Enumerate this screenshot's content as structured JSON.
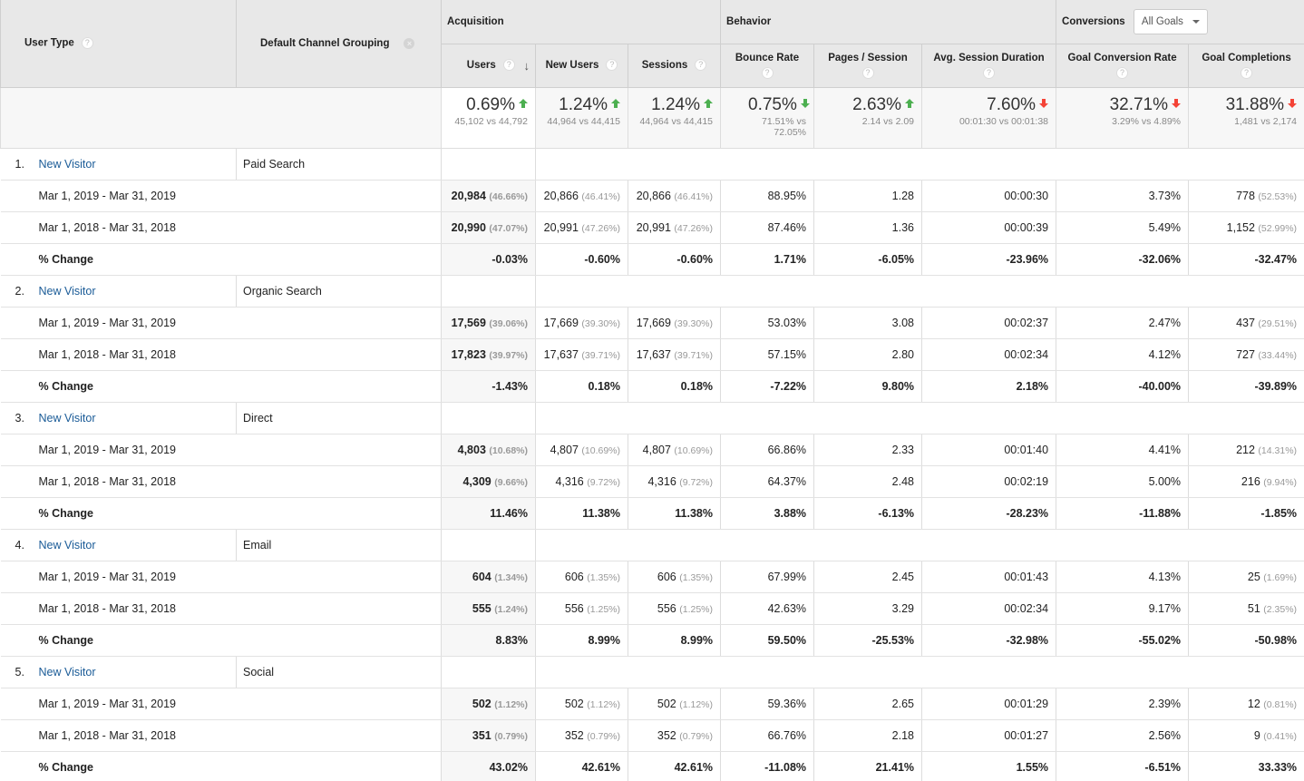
{
  "header": {
    "user_type": "User Type",
    "channel_grouping": "Default Channel Grouping",
    "groups": {
      "acquisition": "Acquisition",
      "behavior": "Behavior",
      "conversions": "Conversions"
    },
    "goal_select": "All Goals",
    "metrics": {
      "users": "Users",
      "new_users": "New Users",
      "sessions": "Sessions",
      "bounce_rate": "Bounce Rate",
      "pages_session": "Pages / Session",
      "avg_duration": "Avg. Session Duration",
      "goal_conv_rate": "Goal Conversion Rate",
      "goal_completions": "Goal Completions"
    },
    "help_icon": "?"
  },
  "summary": {
    "users": {
      "change": "0.69%",
      "direction": "up",
      "color": "#4caf50",
      "compare": "45,102 vs 44,792"
    },
    "new_users": {
      "change": "1.24%",
      "direction": "up",
      "color": "#4caf50",
      "compare": "44,964 vs 44,415"
    },
    "sessions": {
      "change": "1.24%",
      "direction": "up",
      "color": "#4caf50",
      "compare": "44,964 vs 44,415"
    },
    "bounce_rate": {
      "change": "0.75%",
      "direction": "down",
      "color": "#4caf50",
      "compare": "71.51% vs 72.05%"
    },
    "pages_session": {
      "change": "2.63%",
      "direction": "up",
      "color": "#4caf50",
      "compare": "2.14 vs 2.09"
    },
    "avg_duration": {
      "change": "7.60%",
      "direction": "down",
      "color": "#f44336",
      "compare": "00:01:30 vs 00:01:38"
    },
    "goal_conv_rate": {
      "change": "32.71%",
      "direction": "down",
      "color": "#f44336",
      "compare": "3.29% vs 4.89%"
    },
    "goal_completions": {
      "change": "31.88%",
      "direction": "down",
      "color": "#f44336",
      "compare": "1,481 vs 2,174"
    }
  },
  "change_label": "% Change",
  "rows": [
    {
      "index": "1.",
      "user_type": "New Visitor",
      "channel": "Paid Search",
      "periods": [
        {
          "label": "Mar 1, 2019 - Mar 31, 2019",
          "users": "20,984",
          "users_pct": "(46.66%)",
          "new_users": "20,866",
          "new_users_pct": "(46.41%)",
          "sessions": "20,866",
          "sessions_pct": "(46.41%)",
          "bounce_rate": "88.95%",
          "pages_session": "1.28",
          "avg_duration": "00:00:30",
          "goal_conv_rate": "3.73%",
          "goal_completions": "778",
          "goal_completions_pct": "(52.53%)"
        },
        {
          "label": "Mar 1, 2018 - Mar 31, 2018",
          "users": "20,990",
          "users_pct": "(47.07%)",
          "new_users": "20,991",
          "new_users_pct": "(47.26%)",
          "sessions": "20,991",
          "sessions_pct": "(47.26%)",
          "bounce_rate": "87.46%",
          "pages_session": "1.36",
          "avg_duration": "00:00:39",
          "goal_conv_rate": "5.49%",
          "goal_completions": "1,152",
          "goal_completions_pct": "(52.99%)"
        }
      ],
      "change": {
        "users": "-0.03%",
        "new_users": "-0.60%",
        "sessions": "-0.60%",
        "bounce_rate": "1.71%",
        "pages_session": "-6.05%",
        "avg_duration": "-23.96%",
        "goal_conv_rate": "-32.06%",
        "goal_completions": "-32.47%"
      }
    },
    {
      "index": "2.",
      "user_type": "New Visitor",
      "channel": "Organic Search",
      "periods": [
        {
          "label": "Mar 1, 2019 - Mar 31, 2019",
          "users": "17,569",
          "users_pct": "(39.06%)",
          "new_users": "17,669",
          "new_users_pct": "(39.30%)",
          "sessions": "17,669",
          "sessions_pct": "(39.30%)",
          "bounce_rate": "53.03%",
          "pages_session": "3.08",
          "avg_duration": "00:02:37",
          "goal_conv_rate": "2.47%",
          "goal_completions": "437",
          "goal_completions_pct": "(29.51%)"
        },
        {
          "label": "Mar 1, 2018 - Mar 31, 2018",
          "users": "17,823",
          "users_pct": "(39.97%)",
          "new_users": "17,637",
          "new_users_pct": "(39.71%)",
          "sessions": "17,637",
          "sessions_pct": "(39.71%)",
          "bounce_rate": "57.15%",
          "pages_session": "2.80",
          "avg_duration": "00:02:34",
          "goal_conv_rate": "4.12%",
          "goal_completions": "727",
          "goal_completions_pct": "(33.44%)"
        }
      ],
      "change": {
        "users": "-1.43%",
        "new_users": "0.18%",
        "sessions": "0.18%",
        "bounce_rate": "-7.22%",
        "pages_session": "9.80%",
        "avg_duration": "2.18%",
        "goal_conv_rate": "-40.00%",
        "goal_completions": "-39.89%"
      }
    },
    {
      "index": "3.",
      "user_type": "New Visitor",
      "channel": "Direct",
      "periods": [
        {
          "label": "Mar 1, 2019 - Mar 31, 2019",
          "users": "4,803",
          "users_pct": "(10.68%)",
          "new_users": "4,807",
          "new_users_pct": "(10.69%)",
          "sessions": "4,807",
          "sessions_pct": "(10.69%)",
          "bounce_rate": "66.86%",
          "pages_session": "2.33",
          "avg_duration": "00:01:40",
          "goal_conv_rate": "4.41%",
          "goal_completions": "212",
          "goal_completions_pct": "(14.31%)"
        },
        {
          "label": "Mar 1, 2018 - Mar 31, 2018",
          "users": "4,309",
          "users_pct": "(9.66%)",
          "new_users": "4,316",
          "new_users_pct": "(9.72%)",
          "sessions": "4,316",
          "sessions_pct": "(9.72%)",
          "bounce_rate": "64.37%",
          "pages_session": "2.48",
          "avg_duration": "00:02:19",
          "goal_conv_rate": "5.00%",
          "goal_completions": "216",
          "goal_completions_pct": "(9.94%)"
        }
      ],
      "change": {
        "users": "11.46%",
        "new_users": "11.38%",
        "sessions": "11.38%",
        "bounce_rate": "3.88%",
        "pages_session": "-6.13%",
        "avg_duration": "-28.23%",
        "goal_conv_rate": "-11.88%",
        "goal_completions": "-1.85%"
      }
    },
    {
      "index": "4.",
      "user_type": "New Visitor",
      "channel": "Email",
      "periods": [
        {
          "label": "Mar 1, 2019 - Mar 31, 2019",
          "users": "604",
          "users_pct": "(1.34%)",
          "new_users": "606",
          "new_users_pct": "(1.35%)",
          "sessions": "606",
          "sessions_pct": "(1.35%)",
          "bounce_rate": "67.99%",
          "pages_session": "2.45",
          "avg_duration": "00:01:43",
          "goal_conv_rate": "4.13%",
          "goal_completions": "25",
          "goal_completions_pct": "(1.69%)"
        },
        {
          "label": "Mar 1, 2018 - Mar 31, 2018",
          "users": "555",
          "users_pct": "(1.24%)",
          "new_users": "556",
          "new_users_pct": "(1.25%)",
          "sessions": "556",
          "sessions_pct": "(1.25%)",
          "bounce_rate": "42.63%",
          "pages_session": "3.29",
          "avg_duration": "00:02:34",
          "goal_conv_rate": "9.17%",
          "goal_completions": "51",
          "goal_completions_pct": "(2.35%)"
        }
      ],
      "change": {
        "users": "8.83%",
        "new_users": "8.99%",
        "sessions": "8.99%",
        "bounce_rate": "59.50%",
        "pages_session": "-25.53%",
        "avg_duration": "-32.98%",
        "goal_conv_rate": "-55.02%",
        "goal_completions": "-50.98%"
      }
    },
    {
      "index": "5.",
      "user_type": "New Visitor",
      "channel": "Social",
      "periods": [
        {
          "label": "Mar 1, 2019 - Mar 31, 2019",
          "users": "502",
          "users_pct": "(1.12%)",
          "new_users": "502",
          "new_users_pct": "(1.12%)",
          "sessions": "502",
          "sessions_pct": "(1.12%)",
          "bounce_rate": "59.36%",
          "pages_session": "2.65",
          "avg_duration": "00:01:29",
          "goal_conv_rate": "2.39%",
          "goal_completions": "12",
          "goal_completions_pct": "(0.81%)"
        },
        {
          "label": "Mar 1, 2018 - Mar 31, 2018",
          "users": "351",
          "users_pct": "(0.79%)",
          "new_users": "352",
          "new_users_pct": "(0.79%)",
          "sessions": "352",
          "sessions_pct": "(0.79%)",
          "bounce_rate": "66.76%",
          "pages_session": "2.18",
          "avg_duration": "00:01:27",
          "goal_conv_rate": "2.56%",
          "goal_completions": "9",
          "goal_completions_pct": "(0.41%)"
        }
      ],
      "change": {
        "users": "43.02%",
        "new_users": "42.61%",
        "sessions": "42.61%",
        "bounce_rate": "-11.08%",
        "pages_session": "21.41%",
        "avg_duration": "1.55%",
        "goal_conv_rate": "-6.51%",
        "goal_completions": "33.33%"
      }
    }
  ]
}
